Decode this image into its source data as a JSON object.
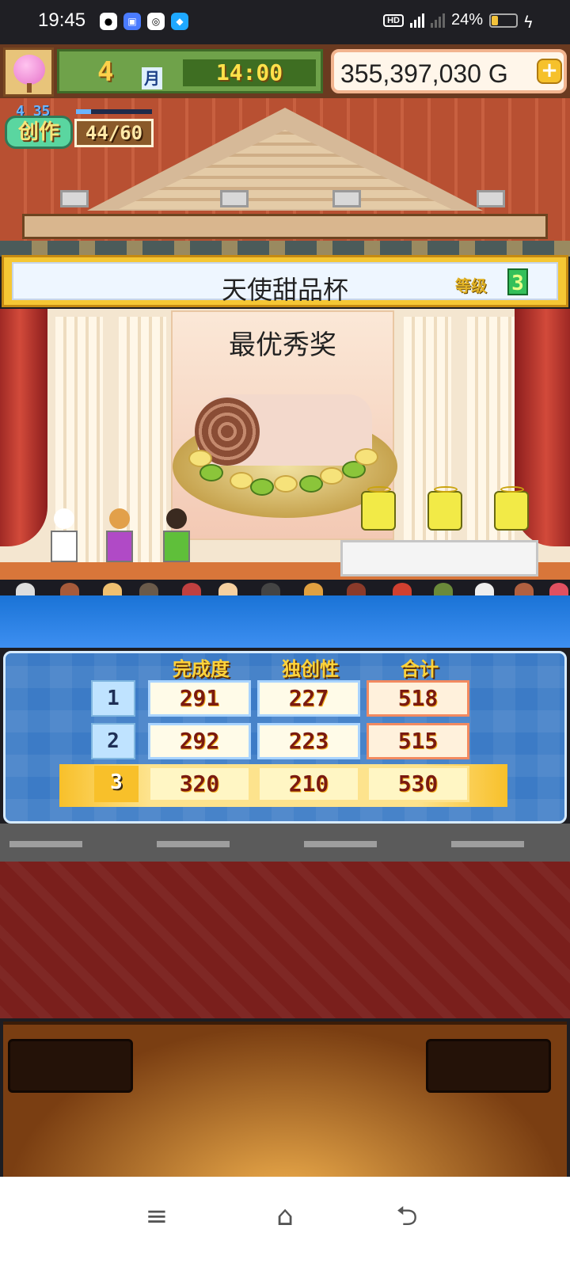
{
  "status_bar": {
    "time": "19:45",
    "battery": "24%"
  },
  "hud": {
    "month": "4",
    "month_label": "月",
    "clock": "14:00",
    "gold": "355,397,030 G",
    "add_gold_label": "+"
  },
  "skill": {
    "level": "4",
    "progress_value": "35",
    "label": "创作",
    "value": "44/60"
  },
  "contest": {
    "name": "天使甜品杯",
    "grade_label": "等级",
    "grade": "3",
    "award": "最优秀奖"
  },
  "results": {
    "headers": [
      "完成度",
      "独创性",
      "合计"
    ],
    "rows": [
      {
        "rank": "1",
        "completion": "291",
        "originality": "227",
        "total": "518"
      },
      {
        "rank": "2",
        "completion": "292",
        "originality": "223",
        "total": "515"
      },
      {
        "rank": "3",
        "completion": "320",
        "originality": "210",
        "total": "530"
      }
    ]
  },
  "nav": {
    "menu": "≡",
    "home": "⌂",
    "back": "⮌"
  }
}
